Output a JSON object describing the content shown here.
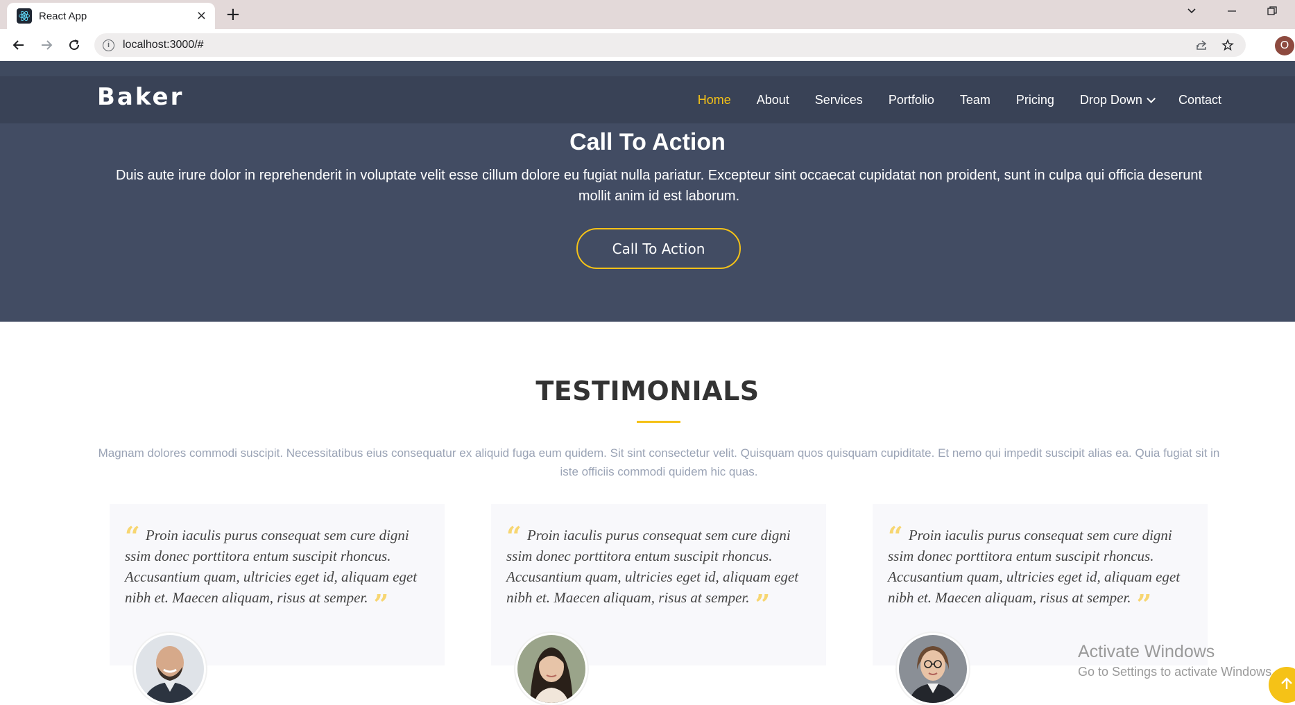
{
  "browser": {
    "tab_title": "React App",
    "url": "localhost:3000/#",
    "profile_initial": "O",
    "new_tab_label": "+",
    "tab_close_label": "×"
  },
  "site": {
    "logo": "Baker",
    "nav": {
      "items": [
        {
          "label": "Home",
          "active": true
        },
        {
          "label": "About"
        },
        {
          "label": "Services"
        },
        {
          "label": "Portfolio"
        },
        {
          "label": "Team"
        },
        {
          "label": "Pricing"
        },
        {
          "label": "Drop Down",
          "has_dropdown": true
        },
        {
          "label": "Contact"
        }
      ]
    }
  },
  "cta": {
    "title": "Call To Action",
    "text": "Duis aute irure dolor in reprehenderit in voluptate velit esse cillum dolore eu fugiat nulla pariatur. Excepteur sint occaecat cupidatat non proident, sunt in culpa qui officia deserunt mollit anim id est laborum.",
    "button_label": "Call To Action"
  },
  "testimonials": {
    "title": "TESTIMONIALS",
    "description": "Magnam dolores commodi suscipit. Necessitatibus eius consequatur ex aliquid fuga eum quidem. Sit sint consectetur velit. Quisquam quos quisquam cupiditate. Et nemo qui impedit suscipit alias ea. Quia fugiat sit in iste officiis commodi quidem hic quas.",
    "items": [
      {
        "quote": "Proin iaculis purus consequat sem cure digni ssim donec porttitora entum suscipit rhoncus. Accusantium quam, ultricies eget id, aliquam eget nibh et. Maecen aliquam, risus at semper."
      },
      {
        "quote": "Proin iaculis purus consequat sem cure digni ssim donec porttitora entum suscipit rhoncus. Accusantium quam, ultricies eget id, aliquam eget nibh et. Maecen aliquam, risus at semper."
      },
      {
        "quote": "Proin iaculis purus consequat sem cure digni ssim donec porttitora entum suscipit rhoncus. Accusantium quam, ultricies eget id, aliquam eget nibh et. Maecen aliquam, risus at semper."
      }
    ]
  },
  "os_watermark": {
    "title": "Activate Windows",
    "subtitle": "Go to Settings to activate Windows."
  },
  "colors": {
    "accent": "#f5c217",
    "header_bg": "#394256",
    "cta_bg": "#424c63"
  }
}
